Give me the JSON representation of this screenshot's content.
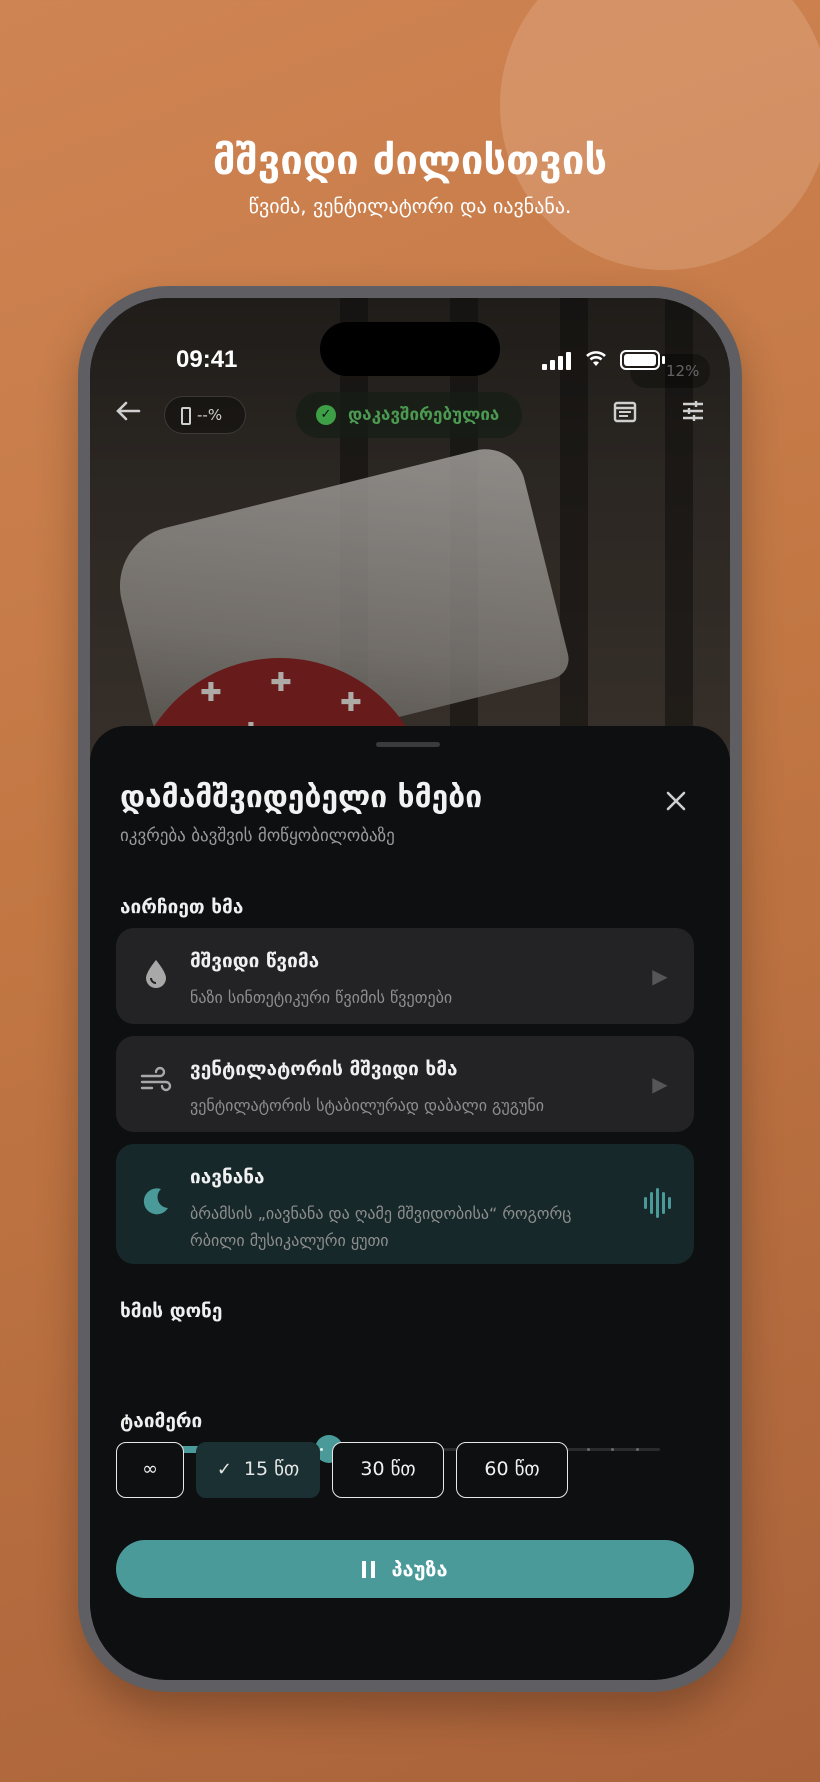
{
  "promo": {
    "title": "მშვიდი ძილისთვის",
    "subtitle": "წვიმა, ვენტილატორი და იავნანა."
  },
  "status_bar": {
    "time": "09:41",
    "volume": "12%"
  },
  "topbar": {
    "battery_label": "--%",
    "connection_label": "დაკავშირებულია"
  },
  "sheet": {
    "title": "დამამშვიდებელი ხმები",
    "subtitle": "იკვრება ბავშვის მოწყობილობაზე",
    "choose_label": "აირჩიეთ ხმა",
    "sounds": [
      {
        "title": "მშვიდი წვიმა",
        "desc": "ნაზი სინთეტიკური წვიმის წვეთები",
        "icon": "drop-icon",
        "active": false
      },
      {
        "title": "ვენტილატორის მშვიდი ხმა",
        "desc": "ვენტილატორის სტაბილურად დაბალი გუგუნი",
        "icon": "wind-icon",
        "active": false
      },
      {
        "title": "იავნანა",
        "desc": "ბრამსის „იავნანა და ღამე მშვიდობისა“ როგორც რბილი მუსიკალური ყუთი",
        "icon": "moon-icon",
        "active": true
      }
    ],
    "volume_label": "ხმის დონე",
    "volume_level": 0.35,
    "timer_label": "ტაიმერი",
    "timers": [
      "∞",
      "15 წთ",
      "30 წთ",
      "60 წთ"
    ],
    "timer_selected": 1,
    "pause_label": "პაუზა"
  },
  "colors": {
    "accent": "#4a9a9a",
    "connected": "#3da046",
    "background": "#0e0f10"
  }
}
